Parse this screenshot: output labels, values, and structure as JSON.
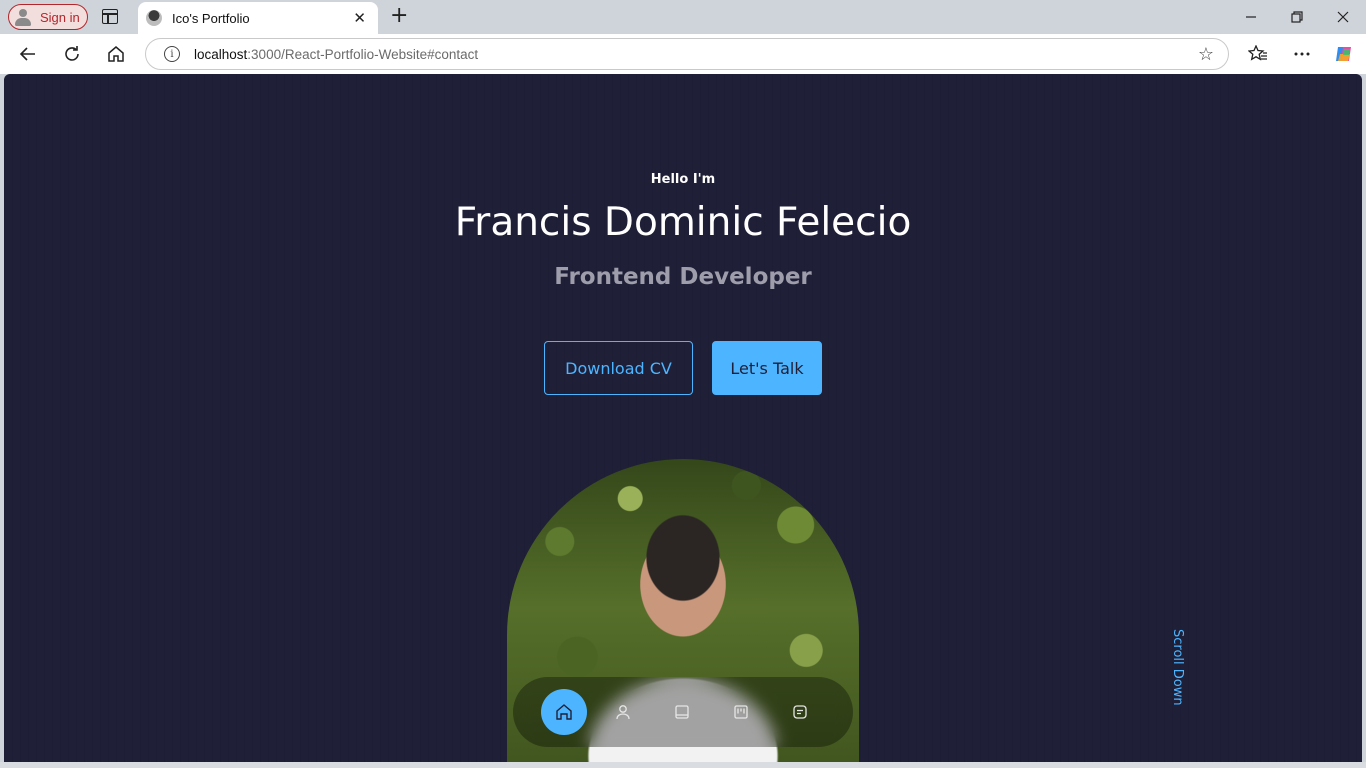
{
  "browser": {
    "sign_in_label": "Sign in",
    "tab_title": "Ico's Portfolio",
    "url_host": "localhost",
    "url_rest": ":3000/React-Portfolio-Website#contact"
  },
  "hero": {
    "greeting": "Hello I'm",
    "name": "Francis Dominic Felecio",
    "role": "Frontend Developer",
    "download_cv_label": "Download CV",
    "lets_talk_label": "Let's Talk",
    "scroll_down_label": "Scroll Down"
  },
  "nav": {
    "items": [
      {
        "icon": "home-icon",
        "active": true
      },
      {
        "icon": "user-icon",
        "active": false
      },
      {
        "icon": "book-icon",
        "active": false
      },
      {
        "icon": "briefcase-icon",
        "active": false
      },
      {
        "icon": "message-icon",
        "active": false
      }
    ]
  },
  "colors": {
    "background": "#1f1f38",
    "primary": "#4db5ff",
    "muted_text": "#9e9dab",
    "white": "#ffffff"
  }
}
